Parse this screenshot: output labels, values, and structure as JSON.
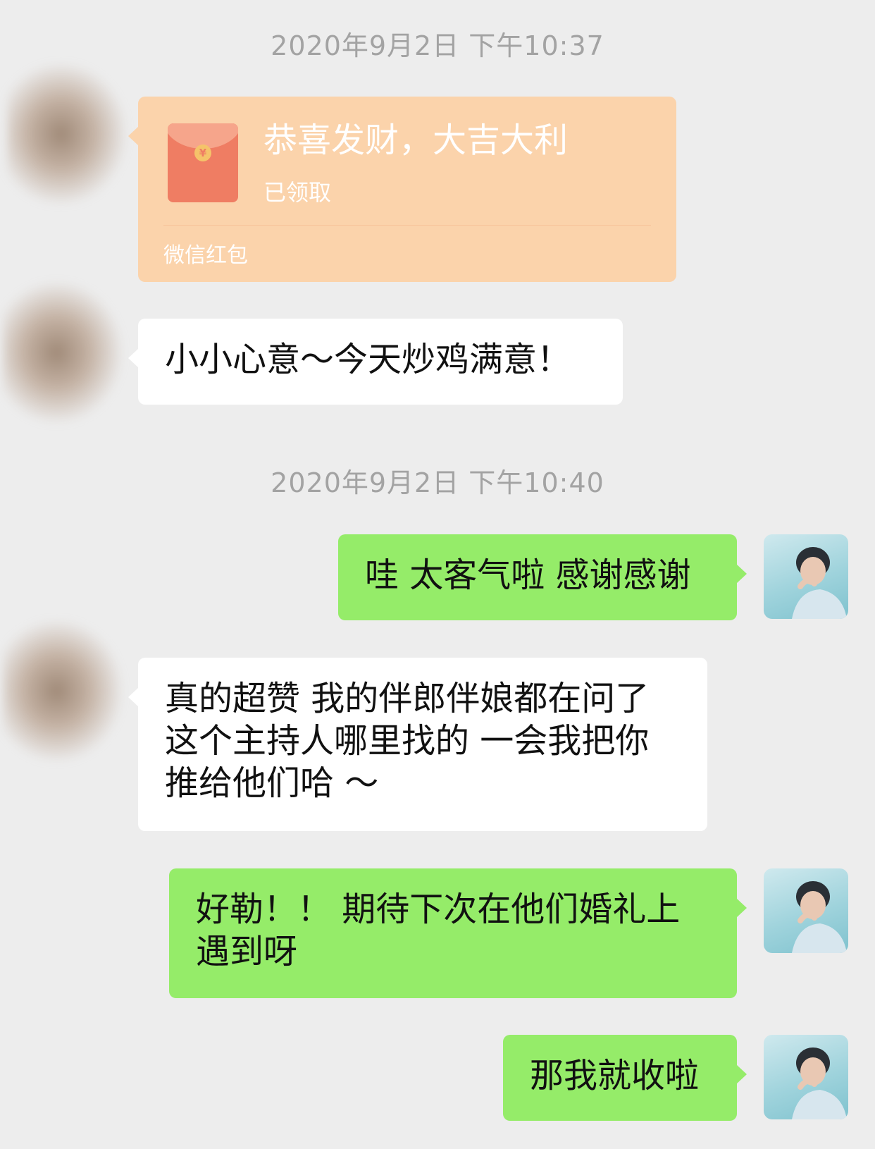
{
  "messages": {
    "ts1": "2020年9月2日 下午10:37",
    "redpacket": {
      "title": "恭喜发财，大吉大利",
      "status": "已领取",
      "footer": "微信红包",
      "coin_symbol": "¥"
    },
    "m1": "小小心意～今天炒鸡满意！",
    "ts2": "2020年9月2日 下午10:40",
    "m2": "哇 太客气啦 感谢感谢",
    "m3_l1": "真的超赞 我的伴郎伴娘都在问了",
    "m3_l2": "这个主持人哪里找的 一会我把你",
    "m3_l3": "推给他们哈 ～",
    "m4_l1": "好勒！！ 期待下次在他们婚礼上",
    "m4_l2": "遇到呀",
    "m5": "那我就收啦"
  },
  "colors": {
    "background": "#ededed",
    "bubble_self": "#95ec69",
    "bubble_other": "#ffffff",
    "redpacket": "#fbd3ab",
    "timestamp": "#a3a3a3"
  }
}
